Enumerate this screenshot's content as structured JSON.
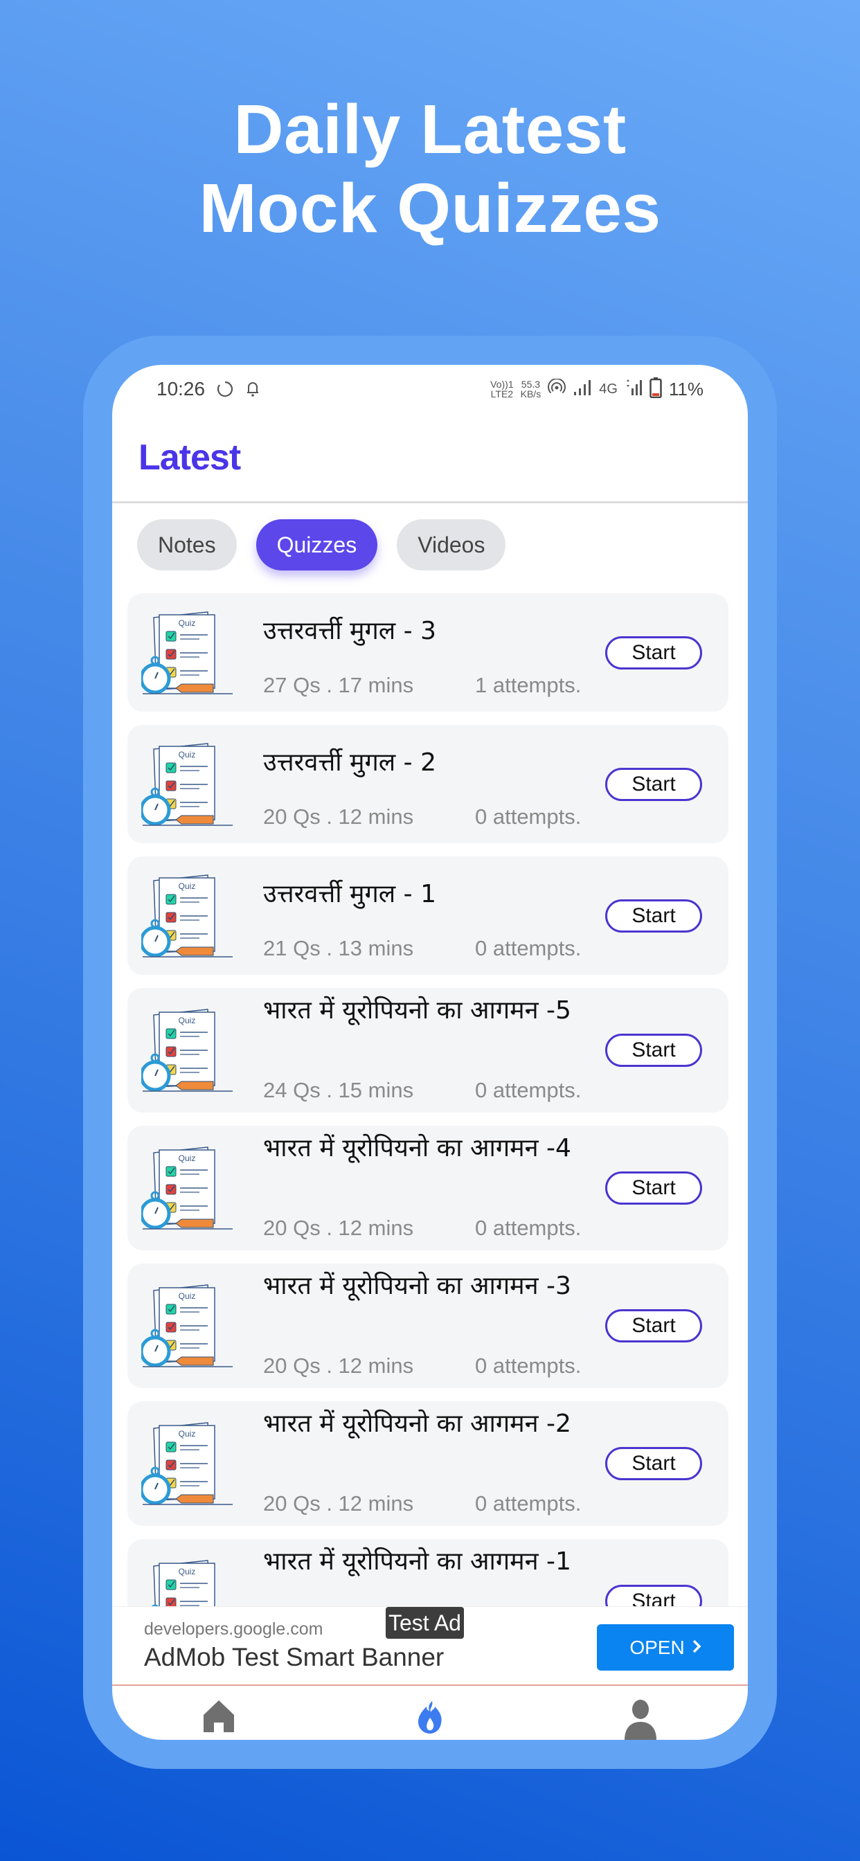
{
  "promo": {
    "headline_line1": "Daily Latest",
    "headline_line2": "Mock Quizzes"
  },
  "statusbar": {
    "time": "10:26",
    "volte_line1": "Vo))1",
    "volte_line2": "LTE2",
    "speed_value": "55.3",
    "speed_unit": "KB/s",
    "network": "4G",
    "battery": "11%"
  },
  "appbar": {
    "title": "Latest"
  },
  "tabs": [
    {
      "label": "Notes",
      "active": false
    },
    {
      "label": "Quizzes",
      "active": true
    },
    {
      "label": "Videos",
      "active": false
    }
  ],
  "quizzes": [
    {
      "title": "उत्तरवर्त्ती मुगल - 3",
      "meta": "27 Qs . 17 mins",
      "attempts": "1 attempts.",
      "button": "Start"
    },
    {
      "title": "उत्तरवर्त्ती मुगल - 2",
      "meta": "20 Qs . 12 mins",
      "attempts": "0 attempts.",
      "button": "Start"
    },
    {
      "title": "उत्तरवर्त्ती मुगल - 1",
      "meta": "21 Qs . 13 mins",
      "attempts": "0 attempts.",
      "button": "Start"
    },
    {
      "title": "भारत में यूरोपियनो का आगमन -5",
      "meta": "24 Qs . 15 mins",
      "attempts": "0 attempts.",
      "button": "Start"
    },
    {
      "title": "भारत में यूरोपियनो का आगमन -4",
      "meta": "20 Qs . 12 mins",
      "attempts": "0 attempts.",
      "button": "Start"
    },
    {
      "title": "भारत में यूरोपियनो का आगमन -3",
      "meta": "20 Qs . 12 mins",
      "attempts": "0 attempts.",
      "button": "Start"
    },
    {
      "title": "भारत में यूरोपियनो का आगमन -2",
      "meta": "20 Qs . 12 mins",
      "attempts": "0 attempts.",
      "button": "Start"
    },
    {
      "title": "भारत में यूरोपियनो का आगमन -1",
      "meta": "",
      "attempts": "",
      "button": "Start"
    }
  ],
  "thumbnail": {
    "label": "Quiz"
  },
  "ad": {
    "badge": "Test Ad",
    "domain": "developers.google.com",
    "title": "AdMob Test Smart Banner",
    "button": "OPEN"
  },
  "bottomnav": [
    {
      "icon": "home-icon",
      "active": false
    },
    {
      "icon": "fire-icon",
      "active": true
    },
    {
      "icon": "person-icon",
      "active": false
    }
  ],
  "colors": {
    "accent": "#5b47ea",
    "title": "#4a35e8",
    "ad_button": "#0a84f0",
    "nav_active": "#3d7bf0",
    "nav_inactive": "#6f6f6f"
  }
}
